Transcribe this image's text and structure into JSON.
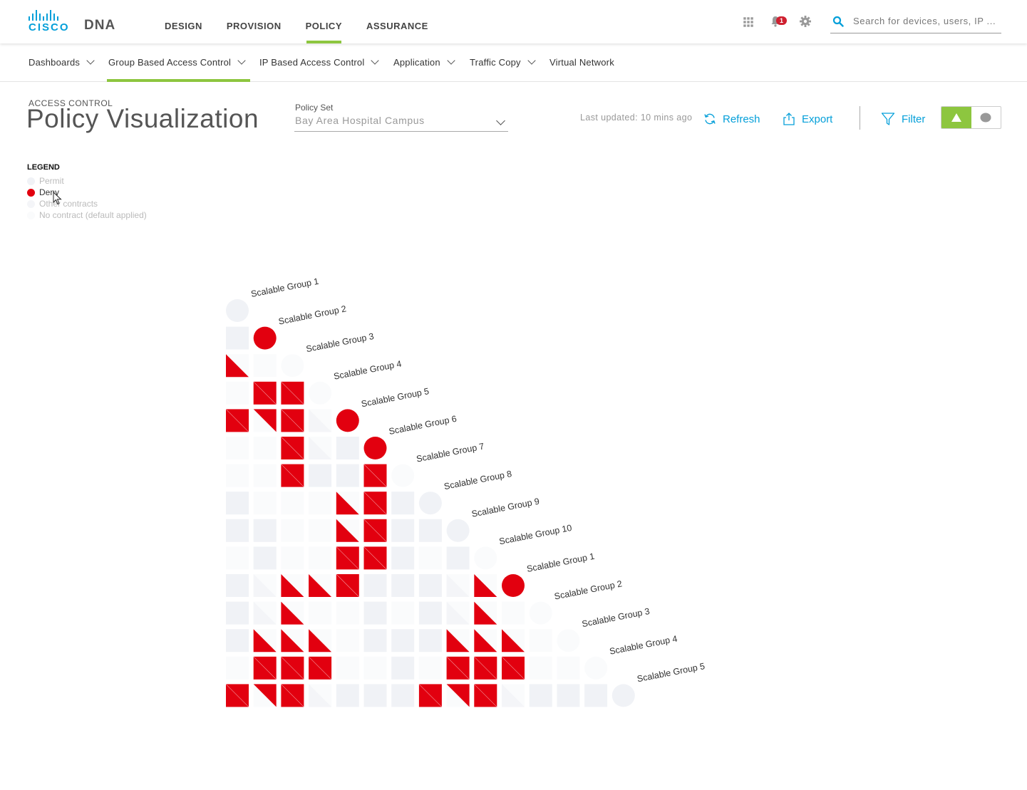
{
  "header": {
    "logo_text": "CISCO",
    "product": "DNA",
    "nav": [
      {
        "label": "DESIGN",
        "active": false
      },
      {
        "label": "PROVISION",
        "active": false
      },
      {
        "label": "POLICY",
        "active": true
      },
      {
        "label": "ASSURANCE",
        "active": false
      }
    ],
    "notification_count": "1",
    "search_placeholder": "Search for devices, users, IP ..."
  },
  "subnav": [
    {
      "label": "Dashboards",
      "dropdown": true,
      "active": false
    },
    {
      "label": "Group Based Access Control",
      "dropdown": true,
      "active": true
    },
    {
      "label": "IP Based Access Control",
      "dropdown": true,
      "active": false
    },
    {
      "label": "Application",
      "dropdown": true,
      "active": false
    },
    {
      "label": "Traffic Copy",
      "dropdown": true,
      "active": false
    },
    {
      "label": "Virtual Network",
      "dropdown": false,
      "active": false
    }
  ],
  "page": {
    "eyebrow": "ACCESS CONTROL",
    "title": "Policy Visualization",
    "policy_set_label": "Policy Set",
    "policy_set_value": "Bay Area Hospital Campus",
    "last_updated": "Last updated: 10 mins ago",
    "refresh_label": "Refresh",
    "export_label": "Export",
    "filter_label": "Filter",
    "view_toggle": {
      "selected": "triangle-view",
      "options": [
        "triangle-view",
        "circle-view"
      ]
    }
  },
  "legend": {
    "title": "LEGEND",
    "items": [
      {
        "label": "Permit",
        "color": "#f0f2f6"
      },
      {
        "label": "Deny",
        "color": "#e2000f"
      },
      {
        "label": "Other contracts",
        "color": "#f4f5f8"
      },
      {
        "label": "No contract (default applied)",
        "color": "#fafbfc"
      }
    ]
  },
  "colors": {
    "accent": "#8dc63f",
    "link": "#049fd9",
    "deny": "#e2000f",
    "permit": "#f0f2f6",
    "other": "#f4f5f8",
    "none": "#fafbfc"
  },
  "matrix": {
    "groups": [
      "Scalable Group 1",
      "Scalable Group 2",
      "Scalable Group 3",
      "Scalable Group 4",
      "Scalable Group 5",
      "Scalable Group 6",
      "Scalable Group 7",
      "Scalable Group 8",
      "Scalable Group 9",
      "Scalable Group 10",
      "Scalable Group 1",
      "Scalable Group 2",
      "Scalable Group 3",
      "Scalable Group 4",
      "Scalable Group 5"
    ],
    "diagonal": [
      "P",
      "D",
      "N",
      "N",
      "D",
      "D",
      "N",
      "P",
      "P",
      "N",
      "D",
      "N",
      "N",
      "N",
      "P"
    ],
    "rows": [
      [
        "P"
      ],
      [
        "T",
        "N"
      ],
      [
        "N",
        "D",
        "D"
      ],
      [
        "D",
        "B",
        "D",
        "C"
      ],
      [
        "N",
        "N",
        "D",
        "C",
        "P"
      ],
      [
        "N",
        "N",
        "D",
        "P",
        "P",
        "D"
      ],
      [
        "P",
        "N",
        "N",
        "N",
        "T",
        "D",
        "P"
      ],
      [
        "P",
        "P",
        "N",
        "N",
        "T",
        "D",
        "P",
        "P"
      ],
      [
        "N",
        "P",
        "N",
        "N",
        "D",
        "D",
        "P",
        "N",
        "P"
      ],
      [
        "P",
        "C",
        "T",
        "T",
        "D",
        "P",
        "P",
        "P",
        "C",
        "T"
      ],
      [
        "P",
        "C",
        "T",
        "N",
        "N",
        "P",
        "N",
        "P",
        "C",
        "T",
        "N"
      ],
      [
        "P",
        "T",
        "T",
        "T",
        "N",
        "P",
        "P",
        "P",
        "T",
        "T",
        "T",
        "N"
      ],
      [
        "N",
        "D",
        "D",
        "D",
        "N",
        "N",
        "P",
        "N",
        "D",
        "D",
        "D",
        "N",
        "N"
      ],
      [
        "D",
        "B",
        "D",
        "C",
        "P",
        "P",
        "P",
        "D",
        "B",
        "D",
        "C",
        "P",
        "P",
        "P"
      ]
    ]
  }
}
